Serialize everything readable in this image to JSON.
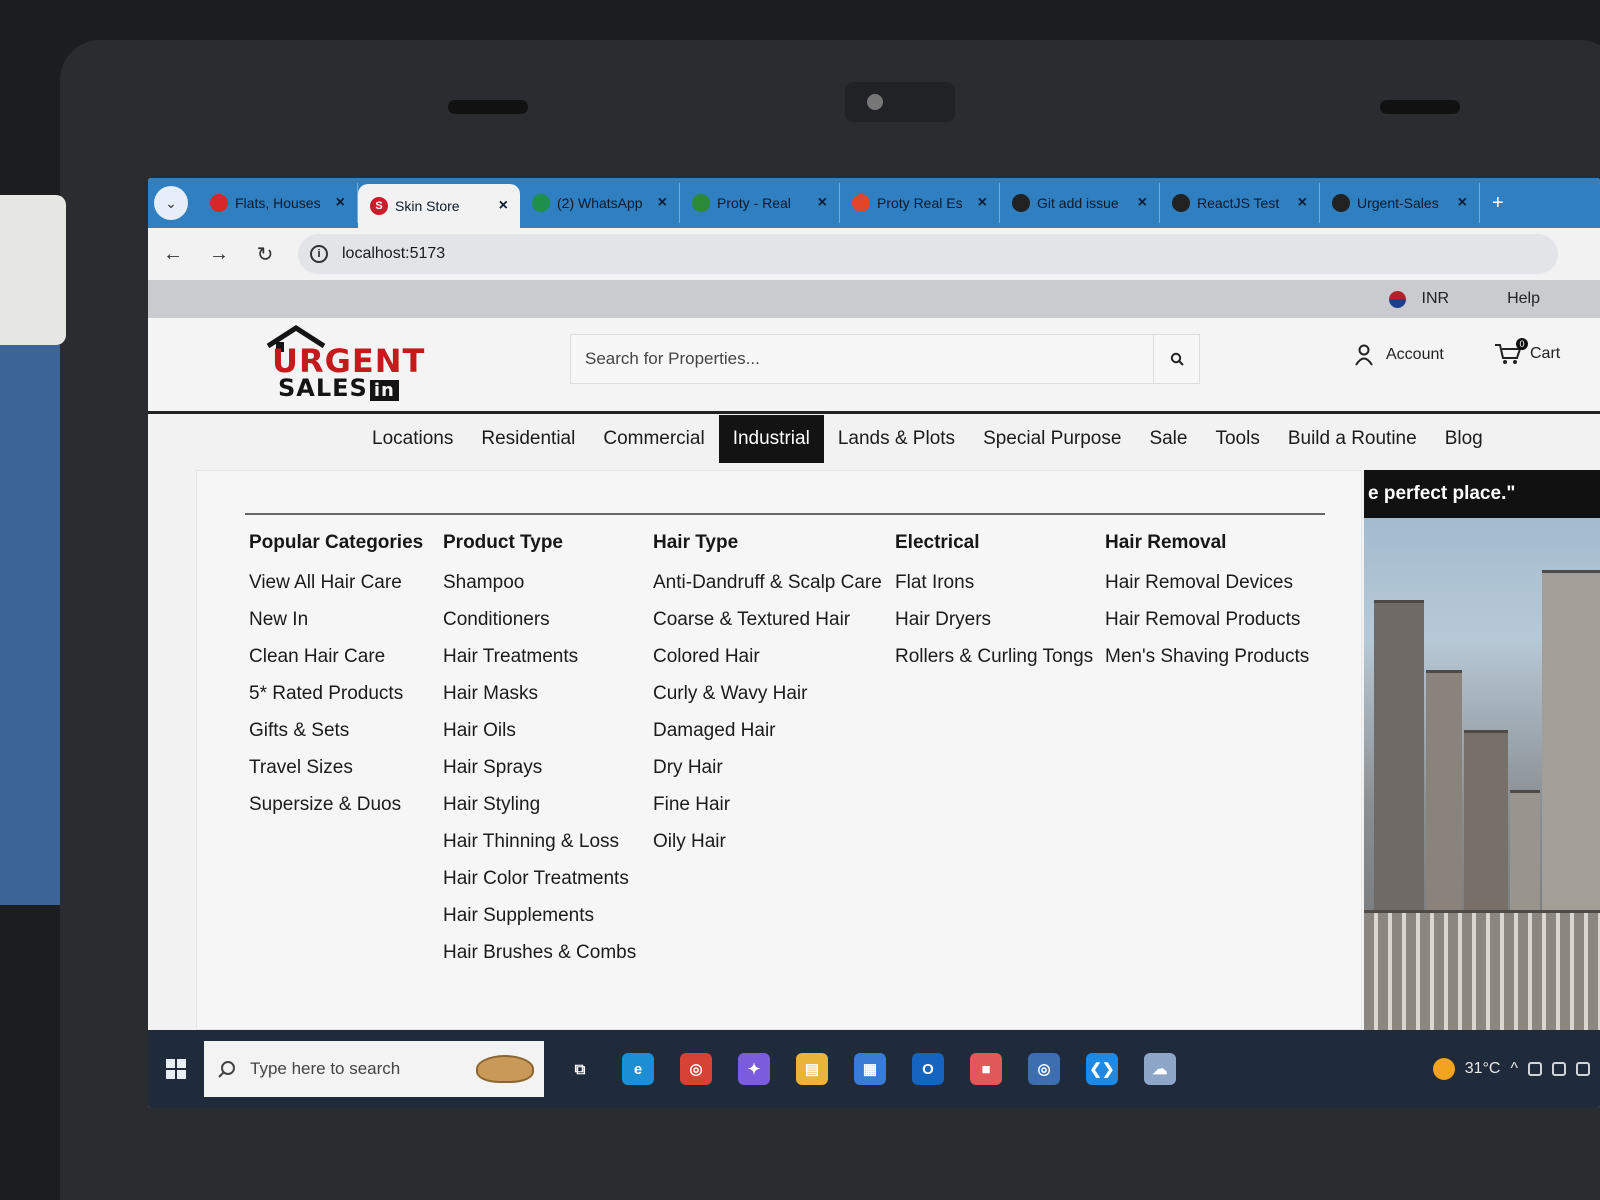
{
  "browser": {
    "tabs": [
      {
        "label": "Flats, Houses",
        "color": "#d8262a",
        "glyph": "",
        "active": false
      },
      {
        "label": "Skin Store",
        "color": "#c81d2b",
        "glyph": "S",
        "active": true
      },
      {
        "label": "(2) WhatsApp",
        "color": "#1f8f4c",
        "glyph": "",
        "active": false
      },
      {
        "label": "Proty - Real",
        "color": "#2a8a38",
        "glyph": "",
        "active": false
      },
      {
        "label": "Proty Real Es",
        "color": "#e0472a",
        "glyph": "",
        "active": false
      },
      {
        "label": "Git add issue",
        "color": "#222222",
        "glyph": "",
        "active": false
      },
      {
        "label": "ReactJS Test",
        "color": "#222222",
        "glyph": "",
        "active": false
      },
      {
        "label": "Urgent-Sales",
        "color": "#222222",
        "glyph": "",
        "active": false
      }
    ],
    "new_tab": "+",
    "url": "localhost:5173"
  },
  "utility": {
    "currency": "INR",
    "help": "Help"
  },
  "header": {
    "logo_line1": "URGENT",
    "logo_line2": "SALES",
    "logo_suffix": "in",
    "search_placeholder": "Search for Properties...",
    "account_label": "Account",
    "cart_label": "Cart",
    "cart_count": "0"
  },
  "nav": {
    "items": [
      "Locations",
      "Residential",
      "Commercial",
      "Industrial",
      "Lands & Plots",
      "Special Purpose",
      "Sale",
      "Tools",
      "Build a Routine",
      "Blog"
    ],
    "active_index": 3
  },
  "mega_menu": {
    "columns": [
      {
        "title": "Popular Categories",
        "items": [
          "View All Hair Care",
          "New In",
          "Clean Hair Care",
          "5* Rated Products",
          "Gifts & Sets",
          "Travel Sizes",
          "Supersize & Duos"
        ]
      },
      {
        "title": "Product Type",
        "items": [
          "Shampoo",
          "Conditioners",
          "Hair Treatments",
          "Hair Masks",
          "Hair Oils",
          "Hair Sprays",
          "Hair Styling",
          "Hair Thinning & Loss",
          "Hair Color Treatments",
          "Hair Supplements",
          "Hair Brushes & Combs"
        ]
      },
      {
        "title": "Hair Type",
        "items": [
          "Anti-Dandruff & Scalp Care",
          "Coarse & Textured Hair",
          "Colored Hair",
          "Curly & Wavy Hair",
          "Damaged Hair",
          "Dry Hair",
          "Fine Hair",
          "Oily Hair"
        ]
      },
      {
        "title": "Electrical",
        "items": [
          "Flat Irons",
          "Hair Dryers",
          "Rollers & Curling Tongs"
        ]
      },
      {
        "title": "Hair Removal",
        "items": [
          "Hair Removal Devices",
          "Hair Removal Products",
          "Men's Shaving Products"
        ]
      }
    ]
  },
  "hero": {
    "quote": "e perfect place.\""
  },
  "taskbar": {
    "search_placeholder": "Type here to search",
    "temperature": "31°C",
    "apps": [
      {
        "name": "task-view",
        "color": "transparent",
        "glyph": "⧉"
      },
      {
        "name": "edge",
        "color": "#1c8fd4",
        "glyph": "e"
      },
      {
        "name": "chrome",
        "color": "#d64235",
        "glyph": "◎"
      },
      {
        "name": "copilot",
        "color": "#7b5cdc",
        "glyph": "✦"
      },
      {
        "name": "file-explorer",
        "color": "#e8b43a",
        "glyph": "▤"
      },
      {
        "name": "store",
        "color": "#3a7bd5",
        "glyph": "▦"
      },
      {
        "name": "outlook",
        "color": "#1565c0",
        "glyph": "O"
      },
      {
        "name": "red-app",
        "color": "#e05858",
        "glyph": "■"
      },
      {
        "name": "chrome-profile",
        "color": "#3d6fb0",
        "glyph": "◎"
      },
      {
        "name": "vscode",
        "color": "#1e88e5",
        "glyph": "❮❯"
      },
      {
        "name": "cloud-app",
        "color": "#8ea6c8",
        "glyph": "☁"
      }
    ]
  },
  "colors": {
    "tab_strip": "#2f7fc1",
    "brand_red": "#c31b1b",
    "nav_active_bg": "#131313",
    "taskbar": "#1f2a3b"
  }
}
